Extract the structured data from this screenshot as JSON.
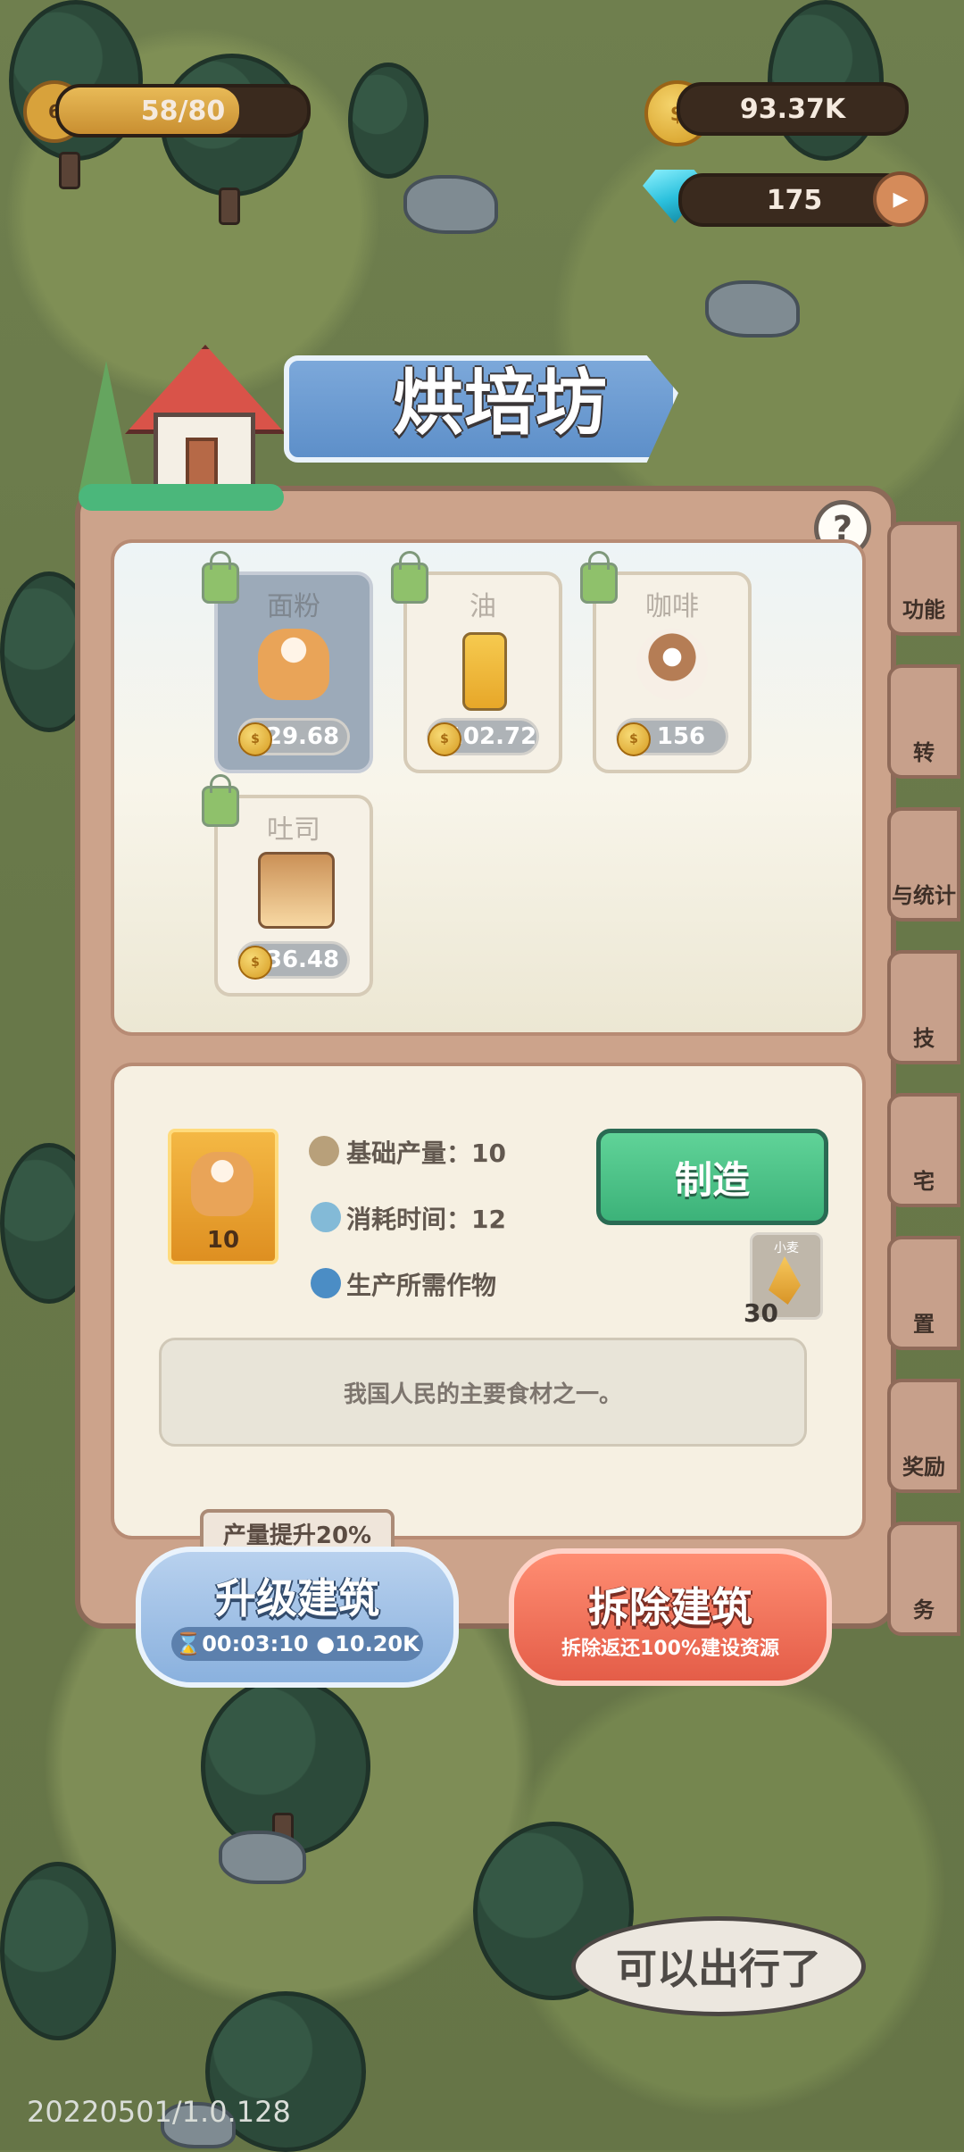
{
  "hud": {
    "level_badge": "6",
    "level_progress_text": "58/80",
    "level_progress_fraction": 0.725,
    "gold": "93.37K",
    "gems": "175"
  },
  "building": {
    "title": "烘培坊",
    "help_label": "?"
  },
  "recipes": [
    {
      "name": "面粉",
      "price": "29.68"
    },
    {
      "name": "油",
      "price": "102.72"
    },
    {
      "name": "咖啡",
      "price": "156"
    },
    {
      "name": "吐司",
      "price": "36.48"
    }
  ],
  "selected_recipe": {
    "item_count": "10",
    "base_output_label": "基础产量：",
    "base_output_value": "10",
    "consume_time_label": "消耗时间：",
    "consume_time_value": "12",
    "required_crop_label": "生产所需作物",
    "craft_button": "制造",
    "material_name": "小麦",
    "material_count": "30",
    "description": "我国人民的主要食材之一。"
  },
  "upgrade": {
    "tag": "产量提升20%",
    "title": "升级建筑",
    "time": "00:03:10",
    "cost": "10.20K"
  },
  "demolish": {
    "title": "拆除建筑",
    "subtitle": "拆除返还100%建设资源"
  },
  "side_tabs": [
    "功能",
    "转",
    "与统计",
    "技",
    "宅",
    "置",
    "奖励",
    "务"
  ],
  "speech_bubble": "可以出行了",
  "version": "20220501/1.0.128"
}
